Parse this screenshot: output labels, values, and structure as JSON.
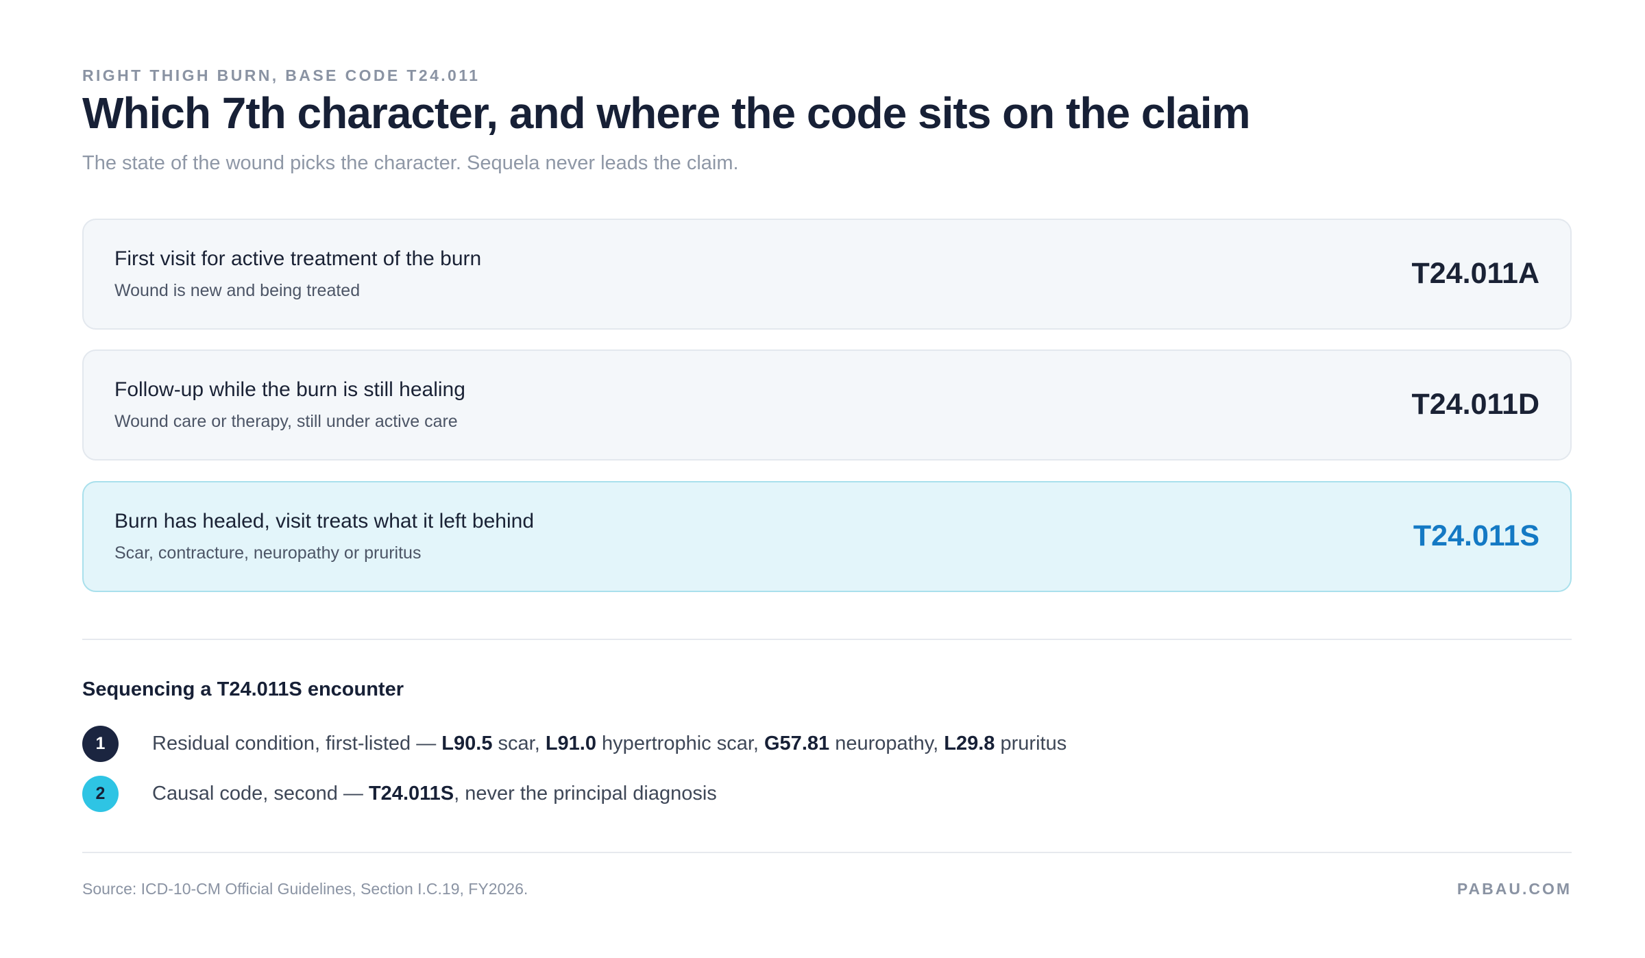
{
  "header": {
    "eyebrow": "RIGHT THIGH BURN, BASE CODE T24.011",
    "title": "Which 7th character, and where the code sits on the claim",
    "subtitle": "The state of the wound picks the character. Sequela never leads the claim."
  },
  "cards": [
    {
      "title": "First visit for active treatment of the burn",
      "description": "Wound is new and being treated",
      "code": "T24.011A"
    },
    {
      "title": "Follow-up while the burn is still healing",
      "description": "Wound care or therapy, still under active care",
      "code": "T24.011D"
    },
    {
      "title": "Burn has healed, visit treats what it left behind",
      "description": "Scar, contracture, neuropathy or pruritus",
      "code": "T24.011S"
    }
  ],
  "sequencing": {
    "heading": "Sequencing a T24.011S encounter",
    "steps": [
      {
        "number": "1",
        "lead": "Residual condition, first-listed — ",
        "code_1": "L90.5",
        "text_1": " scar, ",
        "code_2": "L91.0",
        "text_2": " hypertrophic scar, ",
        "code_3": "G57.81",
        "text_3": " neuropathy, ",
        "code_4": "L29.8",
        "text_4": " pruritus"
      },
      {
        "number": "2",
        "lead": "Causal code, second — ",
        "code_1": "T24.011S",
        "text_1": ", never the principal diagnosis"
      }
    ]
  },
  "footer": {
    "source": "Source: ICD-10-CM Official Guidelines, Section I.C.19, FY2026.",
    "brand": "PABAU.COM"
  },
  "colors": {
    "highlight_code": "#1479c4",
    "step_1_badge": "#1b2540",
    "step_2_badge": "#2ec4e4"
  }
}
